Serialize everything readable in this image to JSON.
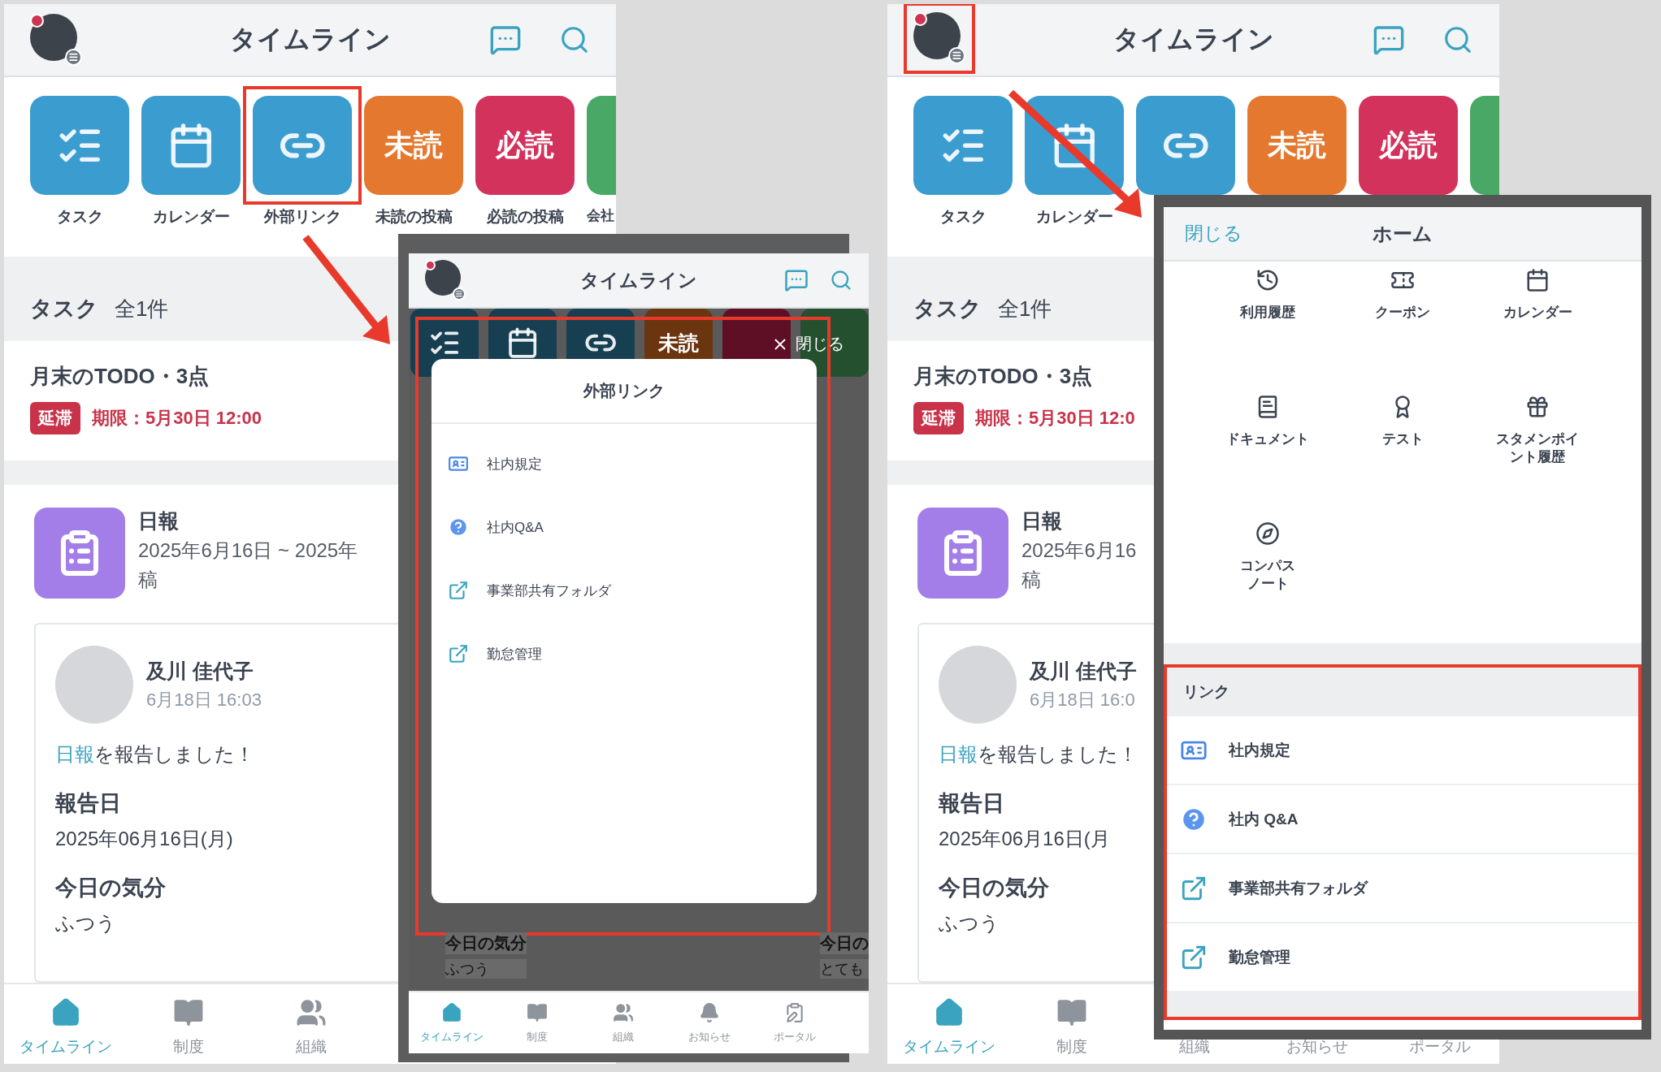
{
  "left_screen": {
    "header": {
      "title": "タイムライン",
      "avatar_highlighted": false
    },
    "tiles": [
      {
        "kind": "checklist",
        "color": "#3b9dcf",
        "label": "タスク",
        "highlighted": false
      },
      {
        "kind": "calendar",
        "color": "#3b9dcf",
        "label": "カレンダー",
        "highlighted": false
      },
      {
        "kind": "link",
        "color": "#3b9dcf",
        "label": "外部リンク",
        "highlighted": true
      },
      {
        "kind": "text",
        "color": "#e4782e",
        "text": "未読",
        "label": "未読の投稿",
        "highlighted": false
      },
      {
        "kind": "text",
        "color": "#d3325d",
        "text": "必読",
        "label": "必読の投稿",
        "highlighted": false
      },
      {
        "kind": "photo",
        "color": "#4aa866",
        "label": "会社",
        "highlighted": false
      }
    ],
    "tasks": {
      "title": "タスク",
      "count": "全1件",
      "item": {
        "title": "月末のTODO・3点",
        "badge": "延滞",
        "deadline": "期限：5月30日 12:00"
      }
    },
    "report": {
      "title": "日報",
      "lines": [
        "2025年6月16日 ~ 2025年",
        "稿"
      ]
    },
    "post": {
      "author": "及川 佳代子",
      "time": "6月18日 16:03",
      "link": "日報",
      "message": "を報告しました！",
      "fields": [
        {
          "label": "報告日",
          "value": "2025年06月16日(月)"
        },
        {
          "label": "今日の気分",
          "value": "ふつう"
        }
      ]
    },
    "nav": [
      {
        "kind": "home",
        "label": "タイムライン",
        "selected": true
      },
      {
        "kind": "book",
        "label": "制度",
        "selected": false
      },
      {
        "kind": "people",
        "label": "組織",
        "selected": false
      }
    ]
  },
  "middle_screen": {
    "header": {
      "title": "タイムライン"
    },
    "tiles": [
      {
        "kind": "checklist",
        "color": "#173f52"
      },
      {
        "kind": "calendar",
        "color": "#173f52"
      },
      {
        "kind": "link",
        "color": "#173f52"
      },
      {
        "kind": "text",
        "color": "#6b3510",
        "text": "未読"
      },
      {
        "kind": "text",
        "color": "#5e0f26"
      },
      {
        "kind": "photo",
        "color": "#24502f"
      }
    ],
    "close": "閉じる",
    "modal": {
      "title": "外部リンク",
      "highlighted": true,
      "items": [
        {
          "kind": "document",
          "label": "社内規定"
        },
        {
          "kind": "question",
          "label": "社内Q&A"
        },
        {
          "kind": "external",
          "label": "事業部共有フォルダ"
        },
        {
          "kind": "external",
          "label": "勤怠管理"
        }
      ]
    },
    "background_texts": [
      {
        "label": "今日の気分",
        "value": "ふつう"
      },
      {
        "label": "今日の",
        "value": "とても"
      }
    ],
    "nav": [
      {
        "kind": "home",
        "label": "タイムライン",
        "selected": true
      },
      {
        "kind": "book",
        "label": "制度",
        "selected": false
      },
      {
        "kind": "people",
        "label": "組織",
        "selected": false
      },
      {
        "kind": "bell",
        "label": "お知らせ",
        "selected": false
      },
      {
        "kind": "clipboard",
        "label": "ポータル",
        "selected": false
      }
    ]
  },
  "right_screen": {
    "header": {
      "title": "タイムライン",
      "avatar_highlighted": true
    },
    "tiles": [
      {
        "kind": "checklist",
        "color": "#3b9dcf",
        "label": "タスク",
        "highlighted": false
      },
      {
        "kind": "calendar",
        "color": "#3b9dcf",
        "label": "カレンダー",
        "highlighted": false
      },
      {
        "kind": "link",
        "color": "#3b9dcf",
        "highlighted": false
      },
      {
        "kind": "text",
        "color": "#e4782e",
        "text": "未読",
        "highlighted": false
      },
      {
        "kind": "text",
        "color": "#d3325d",
        "text": "必読",
        "highlighted": false
      },
      {
        "kind": "photo",
        "color": "#4aa866",
        "highlighted": false
      }
    ],
    "tasks": {
      "title": "タスク",
      "count": "全1件",
      "item": {
        "title": "月末のTODO・3点",
        "badge": "延滞",
        "deadline": "期限：5月30日 12:0"
      }
    },
    "report": {
      "title": "日報",
      "lines": [
        "2025年6月16",
        "稿"
      ]
    },
    "post": {
      "author": "及川 佳代子",
      "time": "6月18日 16:0",
      "link": "日報",
      "message": "を報告しました！",
      "fields": [
        {
          "label": "報告日",
          "value": "2025年06月16日(月"
        },
        {
          "label": "今日の気分",
          "value": "ふつう"
        }
      ]
    },
    "nav": [
      {
        "kind": "home",
        "label": "タイムライン",
        "selected": true
      },
      {
        "kind": "book",
        "label": "制度",
        "selected": false
      },
      {
        "label": "組織",
        "selected": false
      },
      {
        "label": "お知らせ",
        "selected": false
      },
      {
        "label": "ポータル",
        "selected": false
      }
    ]
  },
  "home_menu": {
    "close": "閉じる",
    "title": "ホーム",
    "items": [
      {
        "kind": "history",
        "lines": [
          "利用履歴"
        ]
      },
      {
        "kind": "coupon",
        "lines": [
          "クーポン"
        ]
      },
      {
        "kind": "calendar",
        "lines": [
          "カレンダー"
        ]
      },
      {
        "kind": "document",
        "lines": [
          "ドキュメント"
        ]
      },
      {
        "kind": "test",
        "lines": [
          "テスト"
        ]
      },
      {
        "kind": "gift",
        "lines": [
          "スタメンポイ",
          "ント履歴"
        ]
      },
      {
        "kind": "compass",
        "lines": [
          "コンパス",
          "ノート"
        ]
      }
    ],
    "link_section": {
      "title": "リンク",
      "highlighted": true,
      "items": [
        {
          "kind": "document",
          "label": "社内規定"
        },
        {
          "kind": "question",
          "label": "社内 Q&A"
        },
        {
          "kind": "external",
          "label": "事業部共有フォルダ"
        },
        {
          "kind": "external",
          "label": "勤怠管理"
        }
      ]
    }
  }
}
